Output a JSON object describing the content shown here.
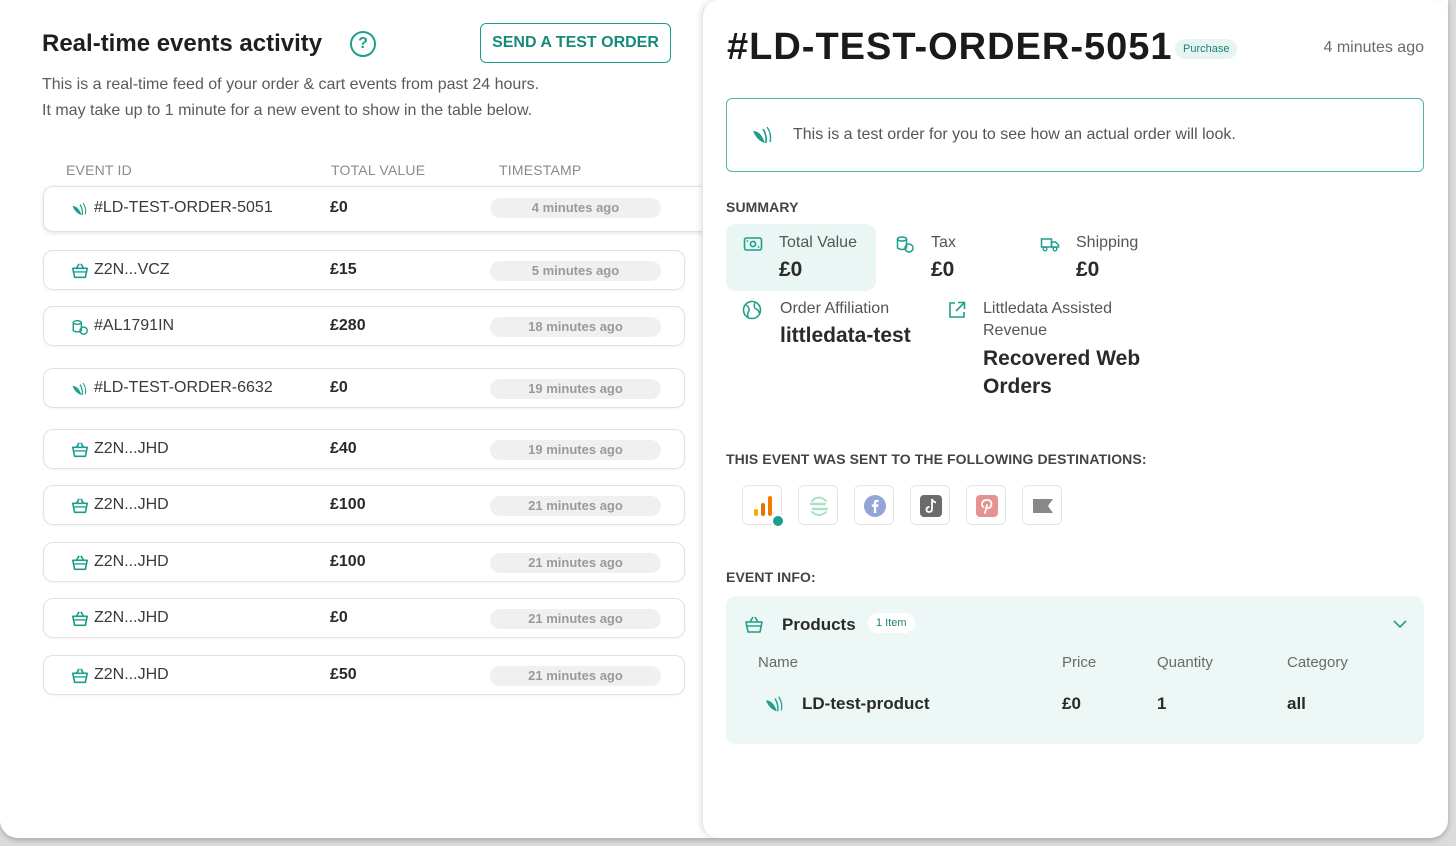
{
  "left": {
    "title": "Real-time events activity",
    "send_button": "SEND A TEST ORDER",
    "description_line1": "This is a real-time feed of your order & cart events from past 24 hours.",
    "description_line2": "It may take up to 1 minute for a new event to show in the table below.",
    "columns": [
      "EVENT ID",
      "TOTAL VALUE",
      "TIMESTAMP"
    ],
    "rows": [
      {
        "icon": "littledata-leaf-icon",
        "id": "#LD-TEST-ORDER-5051",
        "value": "£0",
        "timestamp": "4 minutes ago"
      },
      {
        "icon": "basket-icon",
        "id": "Z2N...VCZ",
        "value": "£15",
        "timestamp": "5 minutes ago"
      },
      {
        "icon": "coins-icon",
        "id": "#AL1791IN",
        "value": "£280",
        "timestamp": "18 minutes ago"
      },
      {
        "icon": "littledata-leaf-icon",
        "id": "#LD-TEST-ORDER-6632",
        "value": "£0",
        "timestamp": "19 minutes ago"
      },
      {
        "icon": "basket-icon",
        "id": "Z2N...JHD",
        "value": "£40",
        "timestamp": "19 minutes ago"
      },
      {
        "icon": "basket-icon",
        "id": "Z2N...JHD",
        "value": "£100",
        "timestamp": "21 minutes ago"
      },
      {
        "icon": "basket-icon",
        "id": "Z2N...JHD",
        "value": "£100",
        "timestamp": "21 minutes ago"
      },
      {
        "icon": "basket-icon",
        "id": "Z2N...JHD",
        "value": "£0",
        "timestamp": "21 minutes ago"
      },
      {
        "icon": "basket-icon",
        "id": "Z2N...JHD",
        "value": "£50",
        "timestamp": "21 minutes ago"
      }
    ]
  },
  "detail": {
    "title": "#LD-TEST-ORDER-5051",
    "badge": "Purchase",
    "time": "4 minutes ago",
    "notice": "This is a test order for you to see how an actual order will look.",
    "summary_label": "SUMMARY",
    "summary": {
      "total_value_label": "Total Value",
      "total_value": "£0",
      "tax_label": "Tax",
      "tax": "£0",
      "shipping_label": "Shipping",
      "shipping": "£0",
      "affiliation_label": "Order Affiliation",
      "affiliation": "littledata-test",
      "assisted_label_1": "Littledata Assisted",
      "assisted_label_2": "Revenue",
      "assisted_value_1": "Recovered Web",
      "assisted_value_2": "Orders"
    },
    "destinations_label": "THIS EVENT WAS SENT TO THE FOLLOWING DESTINATIONS:",
    "destinations": [
      "google-analytics-icon",
      "segment-icon",
      "facebook-icon",
      "tiktok-icon",
      "pinterest-icon",
      "klaviyo-flag-icon"
    ],
    "event_info_label": "EVENT INFO:",
    "products": {
      "title": "Products",
      "count": "1 Item",
      "columns": [
        "Name",
        "Price",
        "Quantity",
        "Category"
      ],
      "rows": [
        {
          "name": "LD-test-product",
          "price": "£0",
          "quantity": "1",
          "category": "all"
        }
      ]
    }
  },
  "colors": {
    "accent": "#1e9e8c",
    "accent_light": "#e9f6f3"
  }
}
